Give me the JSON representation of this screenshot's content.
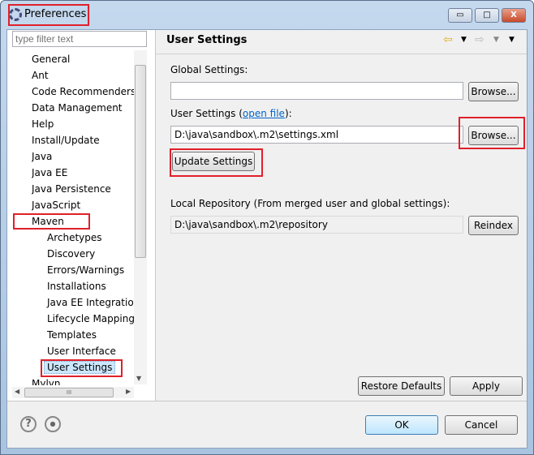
{
  "window": {
    "title": "Preferences",
    "minimize": "▭",
    "maximize": "□",
    "close": "X"
  },
  "filter": {
    "placeholder": "type filter text"
  },
  "tree": {
    "items": [
      {
        "label": "General",
        "level": 0
      },
      {
        "label": "Ant",
        "level": 0
      },
      {
        "label": "Code Recommenders",
        "level": 0
      },
      {
        "label": "Data Management",
        "level": 0
      },
      {
        "label": "Help",
        "level": 0
      },
      {
        "label": "Install/Update",
        "level": 0
      },
      {
        "label": "Java",
        "level": 0
      },
      {
        "label": "Java EE",
        "level": 0
      },
      {
        "label": "Java Persistence",
        "level": 0
      },
      {
        "label": "JavaScript",
        "level": 0
      },
      {
        "label": "Maven",
        "level": 0,
        "expanded": true
      },
      {
        "label": "Archetypes",
        "level": 1
      },
      {
        "label": "Discovery",
        "level": 1
      },
      {
        "label": "Errors/Warnings",
        "level": 1
      },
      {
        "label": "Installations",
        "level": 1
      },
      {
        "label": "Java EE Integration",
        "level": 1
      },
      {
        "label": "Lifecycle Mapping",
        "level": 1
      },
      {
        "label": "Templates",
        "level": 1
      },
      {
        "label": "User Interface",
        "level": 1
      },
      {
        "label": "User Settings",
        "level": 1,
        "selected": true
      },
      {
        "label": "Mylyn",
        "level": 0
      }
    ],
    "hscroll_grip": "III"
  },
  "page": {
    "title": "User Settings",
    "global_settings_label": "Global Settings:",
    "global_settings_value": "",
    "browse1": "Browse...",
    "user_settings_label": "User Settings (",
    "open_file_link": "open file",
    "user_settings_label_end": "):",
    "user_settings_value": "D:\\java\\sandbox\\.m2\\settings.xml",
    "browse2": "Browse...",
    "update_settings": "Update Settings",
    "local_repo_label": "Local Repository (From merged user and global settings):",
    "local_repo_value": "D:\\java\\sandbox\\.m2\\repository",
    "reindex": "Reindex",
    "restore_defaults": "Restore Defaults",
    "apply": "Apply"
  },
  "footer": {
    "help": "?",
    "ok": "OK",
    "cancel": "Cancel"
  },
  "colors": {
    "annotation": "#e0202a",
    "selection": "#cce8ff",
    "link": "#0066cc"
  }
}
